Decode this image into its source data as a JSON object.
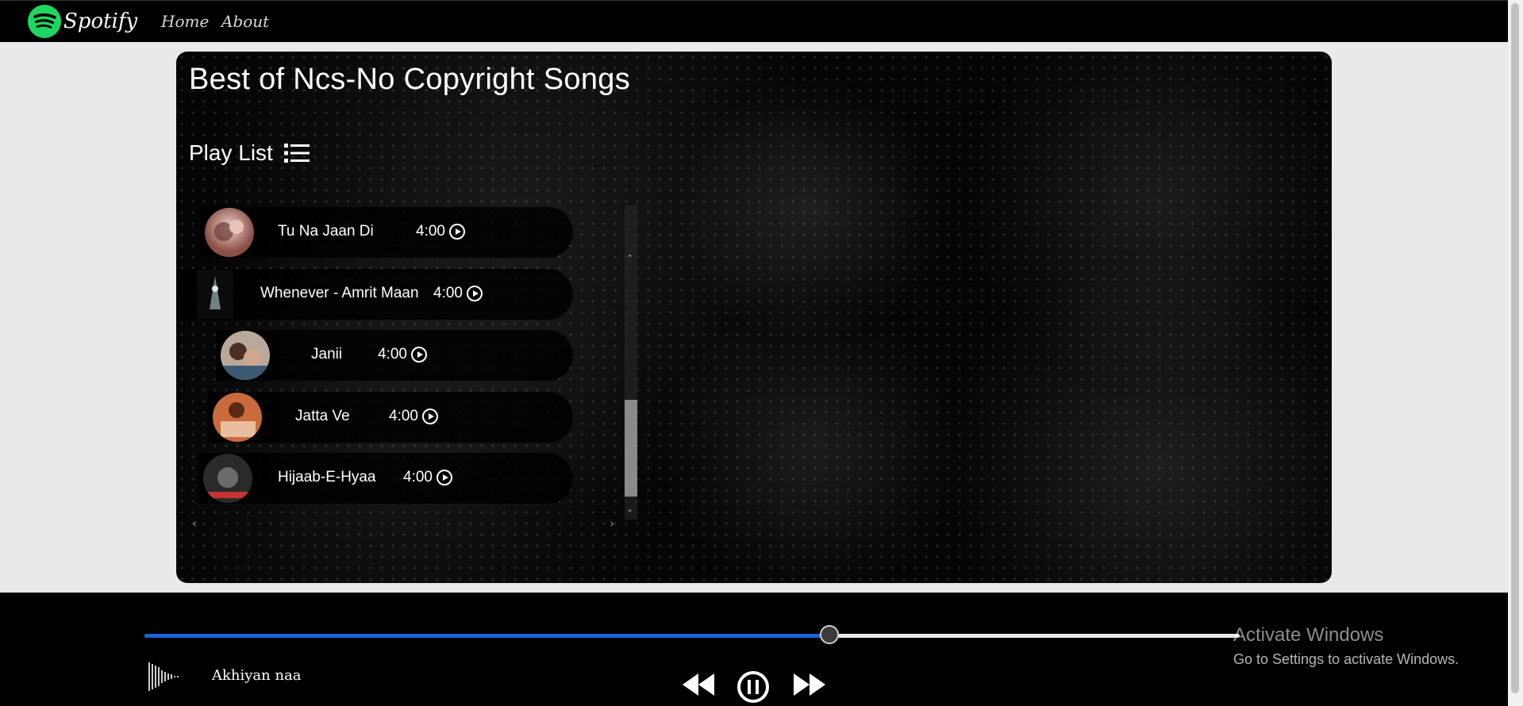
{
  "nav": {
    "brand": "Spotify",
    "links": [
      "Home",
      "About"
    ]
  },
  "main": {
    "title": "Best of Ncs-No Copyright Songs",
    "playlist_heading": "Play List",
    "songs": [
      {
        "name": "Tu Na Jaan Di",
        "duration": "4:00"
      },
      {
        "name": "Whenever - Amrit Maan",
        "duration": "4:00"
      },
      {
        "name": "Janii",
        "duration": "4:00"
      },
      {
        "name": "Jatta Ve",
        "duration": "4:00"
      },
      {
        "name": "Hijaab-E-Hyaa",
        "duration": "4:00"
      }
    ]
  },
  "player": {
    "now_playing": "Akhiyan naa",
    "progress_percent": 62.5,
    "icons": [
      "waveform-icon",
      "previous-icon",
      "pause-icon",
      "next-icon"
    ]
  },
  "overlay": {
    "activate_line1": "Activate Windows",
    "activate_line2": "Go to Settings to activate Windows."
  },
  "colors": {
    "brand_green": "#1ed760",
    "progress_blue": "#1a63d8",
    "background": "#e9e9e9"
  }
}
